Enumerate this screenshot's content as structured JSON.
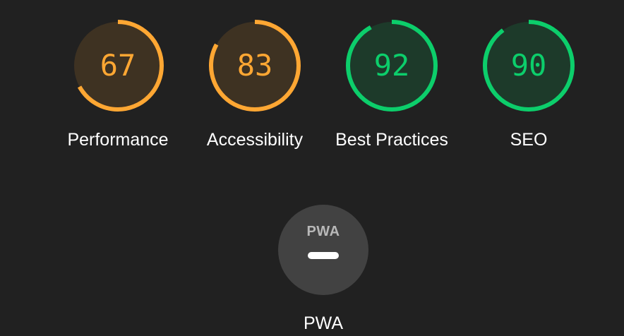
{
  "scores": [
    {
      "id": "performance",
      "value": 67,
      "label": "Performance",
      "color": "#FFA733",
      "bg": "#3E3222"
    },
    {
      "id": "accessibility",
      "value": 83,
      "label": "Accessibility",
      "color": "#FFA733",
      "bg": "#3E3222"
    },
    {
      "id": "best-practices",
      "value": 92,
      "label": "Best Practices",
      "color": "#0CCE6B",
      "bg": "#1D3A2A"
    },
    {
      "id": "seo",
      "value": 90,
      "label": "SEO",
      "color": "#0CCE6B",
      "bg": "#1D3A2A"
    }
  ],
  "pwa": {
    "logo_text": "PWA",
    "label": "PWA",
    "status": "—",
    "bg": "#424242"
  },
  "colors": {
    "page_bg": "#212121",
    "text": "#FFFFFF"
  }
}
